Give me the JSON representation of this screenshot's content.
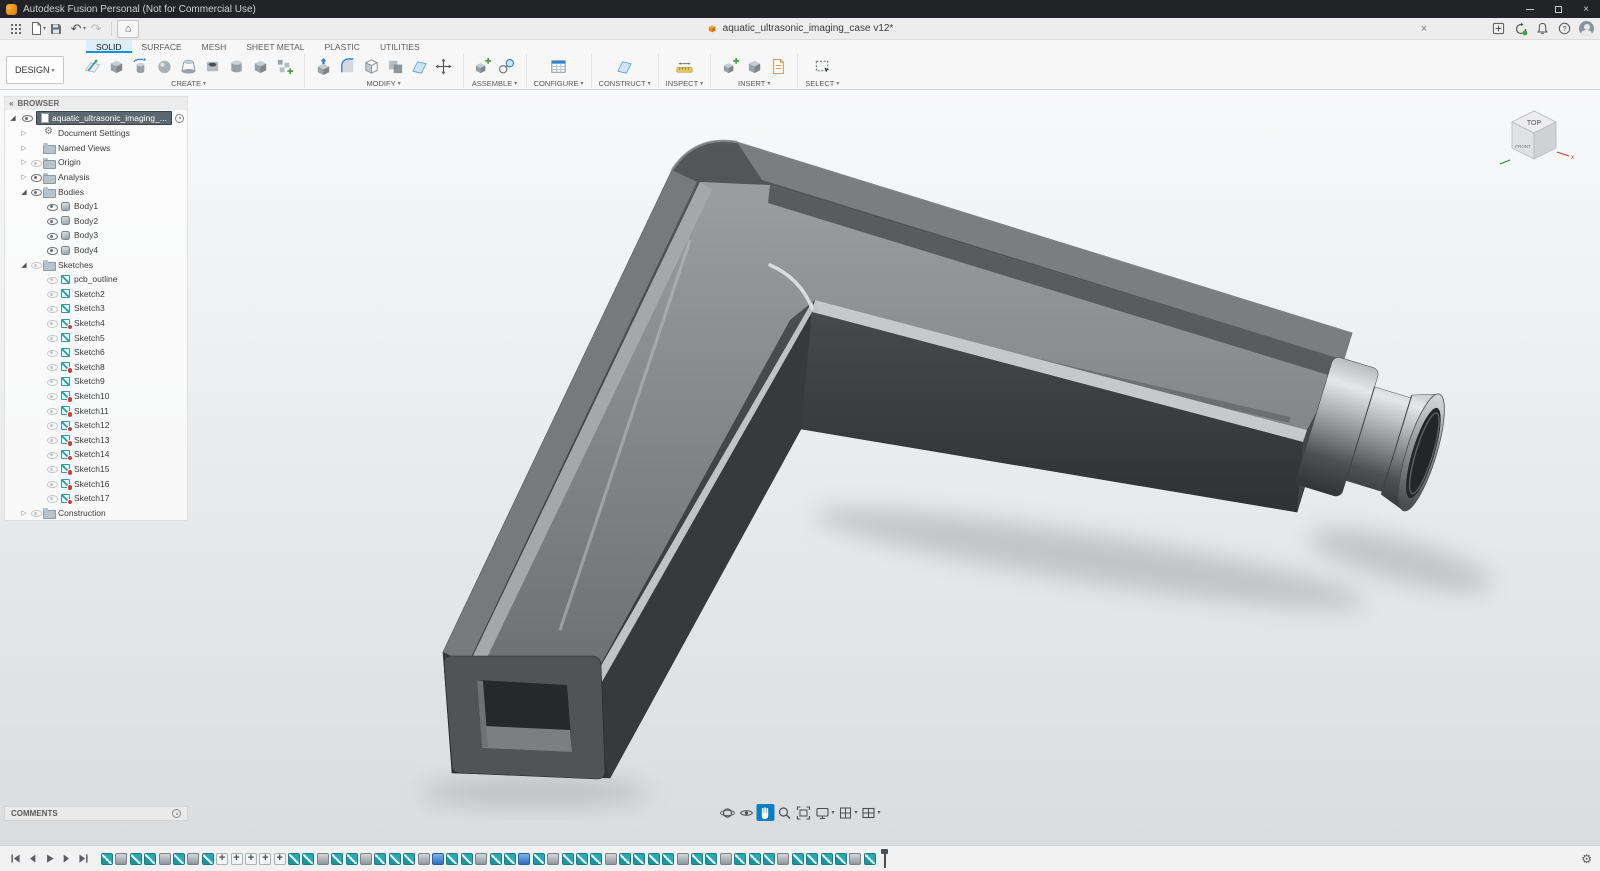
{
  "titlebar": {
    "title": "Autodesk Fusion Personal (Not for Commercial Use)"
  },
  "topbar": {
    "doc_title": "aquatic_ultrasonic_imaging_case v12*",
    "left_icons": [
      "apps-grid-icon",
      "file-menu-icon",
      "save-icon",
      "undo-icon",
      "redo-icon",
      "home-icon"
    ],
    "right_icons": [
      "extensions-icon",
      "job-status-icon",
      "notifications-icon",
      "help-icon",
      "avatar"
    ]
  },
  "ribbon": {
    "design_label": "DESIGN",
    "tabs": [
      {
        "label": "SOLID",
        "active": true
      },
      {
        "label": "SURFACE"
      },
      {
        "label": "MESH"
      },
      {
        "label": "SHEET METAL"
      },
      {
        "label": "PLASTIC"
      },
      {
        "label": "UTILITIES"
      }
    ],
    "groups": [
      {
        "label": "CREATE",
        "items": [
          {
            "name": "create-sketch-icon",
            "glyph": "#g-sketch"
          },
          {
            "name": "extrude-icon",
            "glyph": "#g-cube"
          },
          {
            "name": "revolve-icon",
            "glyph": "#g-revolve"
          },
          {
            "name": "sweep-icon",
            "glyph": "#g-sphere"
          },
          {
            "name": "loft-icon",
            "glyph": "#g-loft"
          },
          {
            "name": "hole-icon",
            "glyph": "#g-hole"
          },
          {
            "name": "thread-icon",
            "glyph": "#g-cylinder"
          },
          {
            "name": "primitive-box-icon",
            "glyph": "#g-cube"
          },
          {
            "name": "pattern-icon",
            "glyph": "#g-pattern"
          }
        ]
      },
      {
        "label": "MODIFY",
        "items": [
          {
            "name": "press-pull-icon",
            "glyph": "#g-presspull"
          },
          {
            "name": "fillet-icon",
            "glyph": "#g-fillet"
          },
          {
            "name": "shell-icon",
            "glyph": "#g-shell"
          },
          {
            "name": "combine-icon",
            "glyph": "#g-combine"
          },
          {
            "name": "offset-face-icon",
            "glyph": "#g-plane"
          },
          {
            "name": "move-copy-icon",
            "glyph": "#g-arrows"
          }
        ]
      },
      {
        "label": "ASSEMBLE",
        "items": [
          {
            "name": "new-component-icon",
            "glyph": "#g-pluscube"
          },
          {
            "name": "joint-icon",
            "glyph": "#g-joint"
          }
        ]
      },
      {
        "label": "CONFIGURE",
        "items": [
          {
            "name": "configure-icon",
            "glyph": "#g-table"
          }
        ]
      },
      {
        "label": "CONSTRUCT",
        "items": [
          {
            "name": "construction-plane-icon",
            "glyph": "#g-plane"
          }
        ]
      },
      {
        "label": "INSPECT",
        "items": [
          {
            "name": "measure-icon",
            "glyph": "#g-measure"
          }
        ]
      },
      {
        "label": "INSERT",
        "items": [
          {
            "name": "insert-derive-icon",
            "glyph": "#g-pluscube"
          },
          {
            "name": "insert-mesh-icon",
            "glyph": "#g-cube"
          },
          {
            "name": "insert-dxf-icon",
            "glyph": "#g-pagedoc"
          }
        ]
      },
      {
        "label": "SELECT",
        "items": [
          {
            "name": "select-icon",
            "glyph": "#g-select"
          }
        ]
      }
    ]
  },
  "browser": {
    "header": "BROWSER",
    "root": {
      "label": "aquatic_ultrasonic_imaging_...",
      "eye": "on"
    },
    "items": [
      {
        "label": "Document Settings",
        "level": 1,
        "arrow": "col",
        "eye": "none",
        "icon": "gear"
      },
      {
        "label": "Named Views",
        "level": 1,
        "arrow": "col",
        "eye": "none",
        "icon": "folder"
      },
      {
        "label": "Origin",
        "level": 1,
        "arrow": "col",
        "eye": "off",
        "icon": "folder"
      },
      {
        "label": "Analysis",
        "level": 1,
        "arrow": "col",
        "eye": "on",
        "icon": "folder"
      },
      {
        "label": "Bodies",
        "level": 1,
        "arrow": "exp",
        "eye": "on",
        "icon": "folder"
      },
      {
        "label": "Body1",
        "level": 2,
        "arrow": "none",
        "eye": "on",
        "icon": "body"
      },
      {
        "label": "Body2",
        "level": 2,
        "arrow": "none",
        "eye": "on",
        "icon": "body"
      },
      {
        "label": "Body3",
        "level": 2,
        "arrow": "none",
        "eye": "on",
        "icon": "body"
      },
      {
        "label": "Body4",
        "level": 2,
        "arrow": "none",
        "eye": "on",
        "icon": "body"
      },
      {
        "label": "Sketches",
        "level": 1,
        "arrow": "exp",
        "eye": "off",
        "icon": "folder"
      },
      {
        "label": "pcb_outline",
        "level": 2,
        "arrow": "none",
        "eye": "off",
        "icon": "sketch"
      },
      {
        "label": "Sketch2",
        "level": 2,
        "arrow": "none",
        "eye": "off",
        "icon": "sketch"
      },
      {
        "label": "Sketch3",
        "level": 2,
        "arrow": "none",
        "eye": "off",
        "icon": "sketch"
      },
      {
        "label": "Sketch4",
        "level": 2,
        "arrow": "none",
        "eye": "off",
        "icon": "sketch",
        "flag": true
      },
      {
        "label": "Sketch5",
        "level": 2,
        "arrow": "none",
        "eye": "off",
        "icon": "sketch"
      },
      {
        "label": "Sketch6",
        "level": 2,
        "arrow": "none",
        "eye": "off",
        "icon": "sketch"
      },
      {
        "label": "Sketch8",
        "level": 2,
        "arrow": "none",
        "eye": "off",
        "icon": "sketch",
        "flag": true
      },
      {
        "label": "Sketch9",
        "level": 2,
        "arrow": "none",
        "eye": "off",
        "icon": "sketch"
      },
      {
        "label": "Sketch10",
        "level": 2,
        "arrow": "none",
        "eye": "off",
        "icon": "sketch",
        "flag": true
      },
      {
        "label": "Sketch11",
        "level": 2,
        "arrow": "none",
        "eye": "off",
        "icon": "sketch",
        "flag": true
      },
      {
        "label": "Sketch12",
        "level": 2,
        "arrow": "none",
        "eye": "off",
        "icon": "sketch",
        "flag": true
      },
      {
        "label": "Sketch13",
        "level": 2,
        "arrow": "none",
        "eye": "off",
        "icon": "sketch",
        "flag": true
      },
      {
        "label": "Sketch14",
        "level": 2,
        "arrow": "none",
        "eye": "off",
        "icon": "sketch",
        "flag": true
      },
      {
        "label": "Sketch15",
        "level": 2,
        "arrow": "none",
        "eye": "off",
        "icon": "sketch",
        "flag": true
      },
      {
        "label": "Sketch16",
        "level": 2,
        "arrow": "none",
        "eye": "off",
        "icon": "sketch",
        "flag": true
      },
      {
        "label": "Sketch17",
        "level": 2,
        "arrow": "none",
        "eye": "off",
        "icon": "sketch",
        "flag": true
      },
      {
        "label": "Construction",
        "level": 1,
        "arrow": "col",
        "eye": "off",
        "icon": "folder"
      }
    ]
  },
  "viewcube": {
    "top": "TOP",
    "front": "FRONT"
  },
  "comments": {
    "label": "COMMENTS"
  },
  "navbar": {
    "items": [
      "orbit-icon",
      "look-at-icon",
      "pan-icon",
      "zoom-icon",
      "fit-icon",
      "display-settings-icon",
      "grid-snaps-icon",
      "viewports-icon"
    ],
    "active": "pan-icon"
  },
  "timeline": {
    "playback": [
      "go-to-start-icon",
      "step-back-icon",
      "play-icon",
      "step-forward-icon",
      "go-to-end-icon"
    ],
    "items": [
      "sketch",
      "feature",
      "sketch",
      "sketch",
      "feature",
      "sketch",
      "feature",
      "sketch",
      "move",
      "move",
      "move",
      "move",
      "move",
      "sketch",
      "sketch",
      "feature",
      "sketch",
      "sketch",
      "feature",
      "sketch",
      "sketch",
      "sketch",
      "feature",
      "hole",
      "sketch",
      "sketch",
      "feature",
      "sketch",
      "sketch",
      "hole",
      "sketch",
      "feature",
      "sketch",
      "sketch",
      "sketch",
      "feature",
      "sketch",
      "sketch",
      "sketch",
      "sketch",
      "feature",
      "sketch",
      "sketch",
      "feature",
      "sketch",
      "sketch",
      "sketch",
      "feature",
      "sketch",
      "sketch",
      "sketch",
      "sketch",
      "feature",
      "sketch"
    ]
  }
}
